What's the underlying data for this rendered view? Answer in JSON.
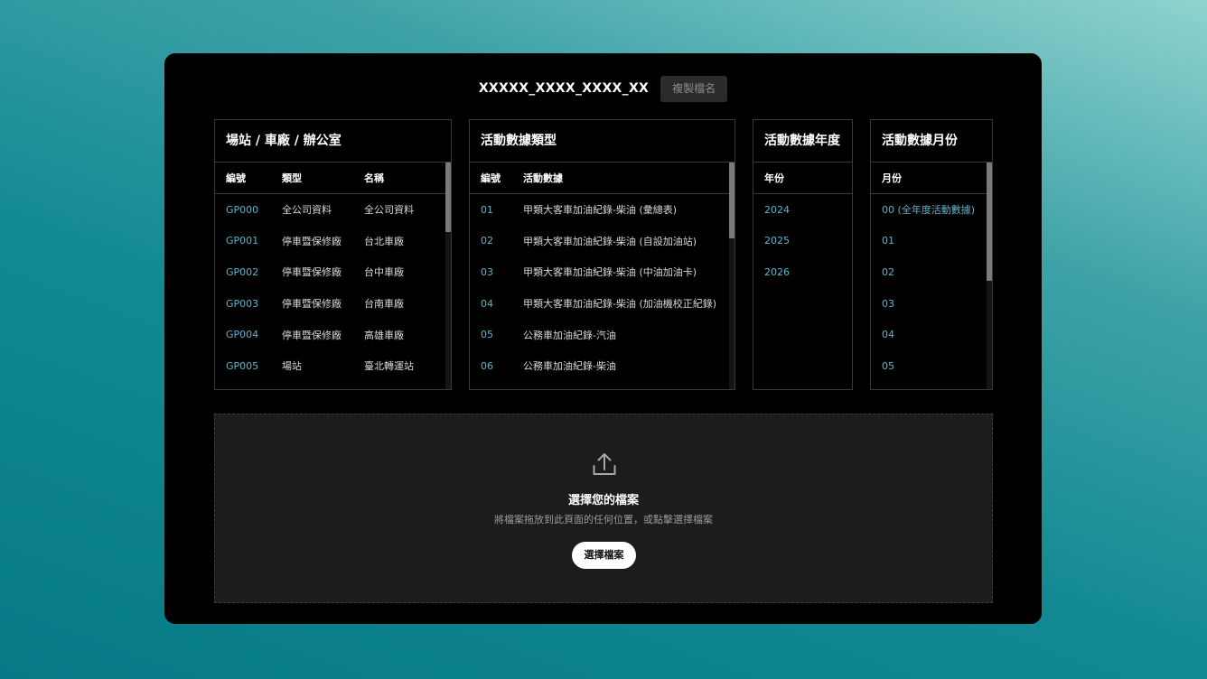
{
  "header": {
    "filename": "XXXXX_XXXX_XXXX_XX",
    "copy_label": "複製檔名"
  },
  "stations": {
    "title": "場站 / 車廠 / 辦公室",
    "columns": [
      "編號",
      "類型",
      "名稱"
    ],
    "rows": [
      {
        "code": "GP000",
        "type": "全公司資料",
        "name": "全公司資料"
      },
      {
        "code": "GP001",
        "type": "停車暨保修廠",
        "name": "台北車廠"
      },
      {
        "code": "GP002",
        "type": "停車暨保修廠",
        "name": "台中車廠"
      },
      {
        "code": "GP003",
        "type": "停車暨保修廠",
        "name": "台南車廠"
      },
      {
        "code": "GP004",
        "type": "停車暨保修廠",
        "name": "高雄車廠"
      },
      {
        "code": "GP005",
        "type": "場站",
        "name": "臺北轉運站"
      }
    ]
  },
  "activity": {
    "title": "活動數據類型",
    "columns": [
      "編號",
      "活動數據"
    ],
    "rows": [
      {
        "code": "01",
        "name": "甲類大客車加油紀錄-柴油 (彙總表)"
      },
      {
        "code": "02",
        "name": "甲類大客車加油紀錄-柴油 (自設加油站)"
      },
      {
        "code": "03",
        "name": "甲類大客車加油紀錄-柴油 (中油加油卡)"
      },
      {
        "code": "04",
        "name": "甲類大客車加油紀錄-柴油 (加油機校正紀錄)"
      },
      {
        "code": "05",
        "name": "公務車加油紀錄-汽油"
      },
      {
        "code": "06",
        "name": "公務車加油紀錄-柴油"
      }
    ]
  },
  "years": {
    "title": "活動數據年度",
    "column": "年份",
    "rows": [
      "2024",
      "2025",
      "2026"
    ]
  },
  "months": {
    "title": "活動數據月份",
    "column": "月份",
    "rows": [
      "00 (全年度活動數據)",
      "01",
      "02",
      "03",
      "04",
      "05"
    ]
  },
  "upload": {
    "title": "選擇您的檔案",
    "hint": "將檔案拖放到此頁面的任何位置，或點擊選擇檔案",
    "button_label": "選擇檔案",
    "icon": "upload-icon"
  },
  "colors": {
    "accent": "#5fb3cc",
    "card": "#000000",
    "dropzone": "#1c1c1c"
  }
}
